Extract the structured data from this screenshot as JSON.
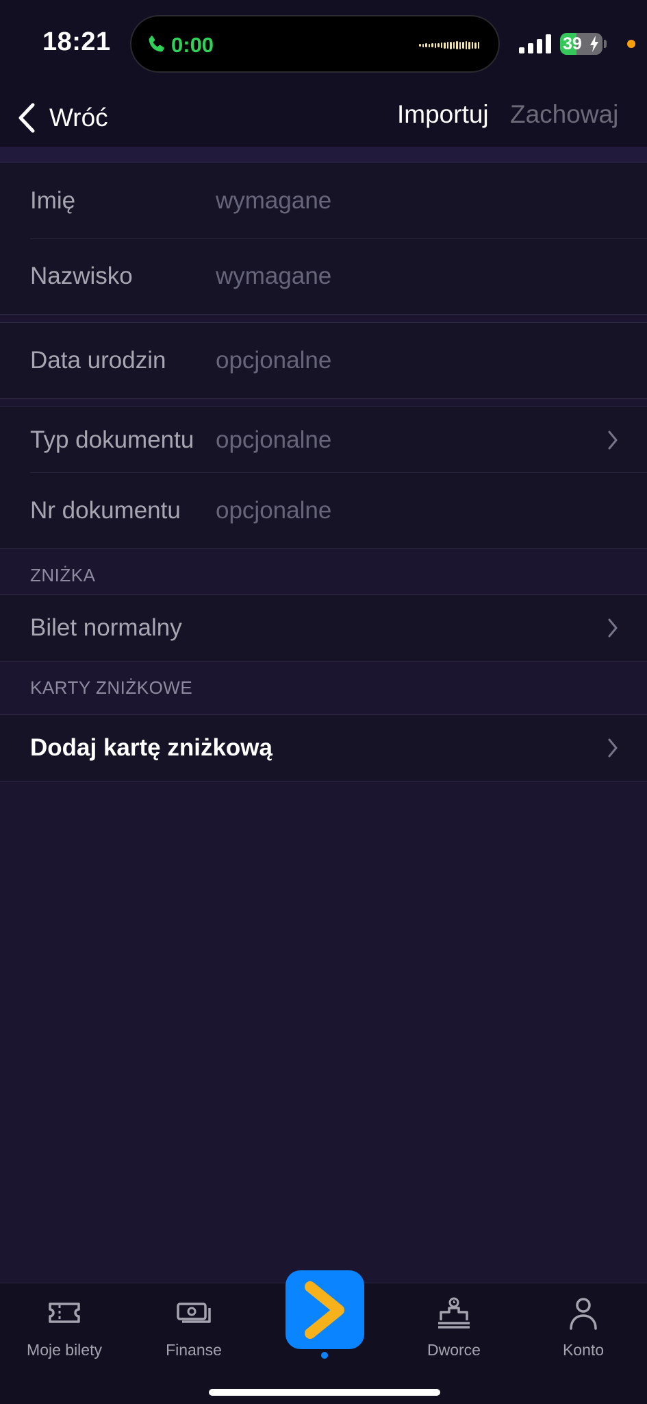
{
  "status_bar": {
    "time": "18:21",
    "call_time": "0:00",
    "battery_percent": 39,
    "battery_label": "39"
  },
  "nav": {
    "back_label": "Wróć",
    "import_label": "Importuj",
    "save_label": "Zachowaj"
  },
  "form": {
    "first_name": {
      "label": "Imię",
      "placeholder": "wymagane"
    },
    "last_name": {
      "label": "Nazwisko",
      "placeholder": "wymagane"
    },
    "birth_date": {
      "label": "Data urodzin",
      "placeholder": "opcjonalne"
    },
    "doc_type": {
      "label": "Typ dokumentu",
      "placeholder": "opcjonalne"
    },
    "doc_number": {
      "label": "Nr dokumentu",
      "placeholder": "opcjonalne"
    }
  },
  "discount": {
    "header": "ZNIŻKA",
    "value": "Bilet normalny"
  },
  "discount_cards": {
    "header": "KARTY ZNIŻKOWE",
    "add_label": "Dodaj kartę zniżkową"
  },
  "tabbar": {
    "tabs": [
      {
        "label": "Moje bilety",
        "icon": "ticket-icon"
      },
      {
        "label": "Finanse",
        "icon": "money-icon"
      },
      {
        "label": "",
        "icon": "chevron-right-icon"
      },
      {
        "label": "Dworce",
        "icon": "station-icon"
      },
      {
        "label": "Konto",
        "icon": "person-icon"
      }
    ]
  },
  "colors": {
    "accent": "#0a84ff",
    "brand_chevron": "#f7b21b",
    "background": "#1b1530",
    "call_green": "#30d158",
    "battery_green": "#34c759"
  }
}
